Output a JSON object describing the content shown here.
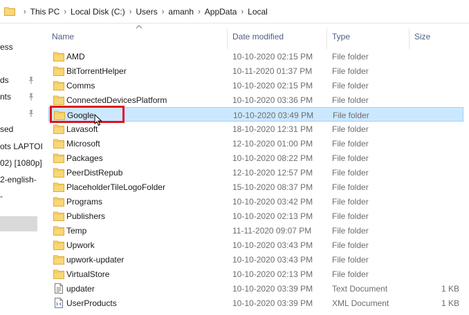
{
  "address": {
    "crumbs": [
      "This PC",
      "Local Disk (C:)",
      "Users",
      "amanh",
      "AppData",
      "Local"
    ],
    "separator": "›"
  },
  "nav": {
    "items": [
      {
        "label": "ess",
        "pinned": false
      },
      {
        "label": "ds",
        "pinned": true
      },
      {
        "label": "nts",
        "pinned": true
      },
      {
        "label": "",
        "pinned": true
      },
      {
        "label": "sed",
        "pinned": false
      },
      {
        "label": "ots LAPTOI",
        "pinned": false
      },
      {
        "label": "02) [1080p]",
        "pinned": false
      },
      {
        "label": "2-english-",
        "pinned": false
      },
      {
        "label": "-",
        "pinned": false
      }
    ]
  },
  "columns": {
    "name": "Name",
    "date_modified": "Date modified",
    "type": "Type",
    "size": "Size"
  },
  "rows": [
    {
      "name": "AMD",
      "date": "10-10-2020 02:15 PM",
      "type": "File folder",
      "size": "",
      "icon": "folder-icon"
    },
    {
      "name": "BitTorrentHelper",
      "date": "10-11-2020 01:37 PM",
      "type": "File folder",
      "size": "",
      "icon": "folder-icon"
    },
    {
      "name": "Comms",
      "date": "10-10-2020 02:15 PM",
      "type": "File folder",
      "size": "",
      "icon": "folder-icon"
    },
    {
      "name": "ConnectedDevicesPlatform",
      "date": "10-10-2020 03:36 PM",
      "type": "File folder",
      "size": "",
      "icon": "folder-icon"
    },
    {
      "name": "Google",
      "date": "10-10-2020 03:49 PM",
      "type": "File folder",
      "size": "",
      "icon": "folder-icon",
      "selected": true
    },
    {
      "name": "Lavasoft",
      "date": "18-10-2020 12:31 PM",
      "type": "File folder",
      "size": "",
      "icon": "folder-icon"
    },
    {
      "name": "Microsoft",
      "date": "12-10-2020 01:00 PM",
      "type": "File folder",
      "size": "",
      "icon": "folder-icon"
    },
    {
      "name": "Packages",
      "date": "10-10-2020 08:22 PM",
      "type": "File folder",
      "size": "",
      "icon": "folder-icon"
    },
    {
      "name": "PeerDistRepub",
      "date": "12-10-2020 12:57 PM",
      "type": "File folder",
      "size": "",
      "icon": "folder-icon"
    },
    {
      "name": "PlaceholderTileLogoFolder",
      "date": "15-10-2020 08:37 PM",
      "type": "File folder",
      "size": "",
      "icon": "folder-icon"
    },
    {
      "name": "Programs",
      "date": "10-10-2020 03:42 PM",
      "type": "File folder",
      "size": "",
      "icon": "folder-icon"
    },
    {
      "name": "Publishers",
      "date": "10-10-2020 02:13 PM",
      "type": "File folder",
      "size": "",
      "icon": "folder-icon"
    },
    {
      "name": "Temp",
      "date": "11-11-2020 09:07 PM",
      "type": "File folder",
      "size": "",
      "icon": "folder-icon"
    },
    {
      "name": "Upwork",
      "date": "10-10-2020 03:43 PM",
      "type": "File folder",
      "size": "",
      "icon": "folder-icon"
    },
    {
      "name": "upwork-updater",
      "date": "10-10-2020 03:43 PM",
      "type": "File folder",
      "size": "",
      "icon": "folder-icon"
    },
    {
      "name": "VirtualStore",
      "date": "10-10-2020 02:13 PM",
      "type": "File folder",
      "size": "",
      "icon": "folder-icon"
    },
    {
      "name": "updater",
      "date": "10-10-2020 03:39 PM",
      "type": "Text Document",
      "size": "1 KB",
      "icon": "text-document-icon"
    },
    {
      "name": "UserProducts",
      "date": "10-10-2020 03:39 PM",
      "type": "XML Document",
      "size": "1 KB",
      "icon": "xml-document-icon"
    }
  ],
  "colors": {
    "selection_bg": "#cce8ff",
    "selection_border": "#99d1ff",
    "highlight": "#e0121d",
    "folder": "#f8d775",
    "header_text": "#4d6082"
  }
}
